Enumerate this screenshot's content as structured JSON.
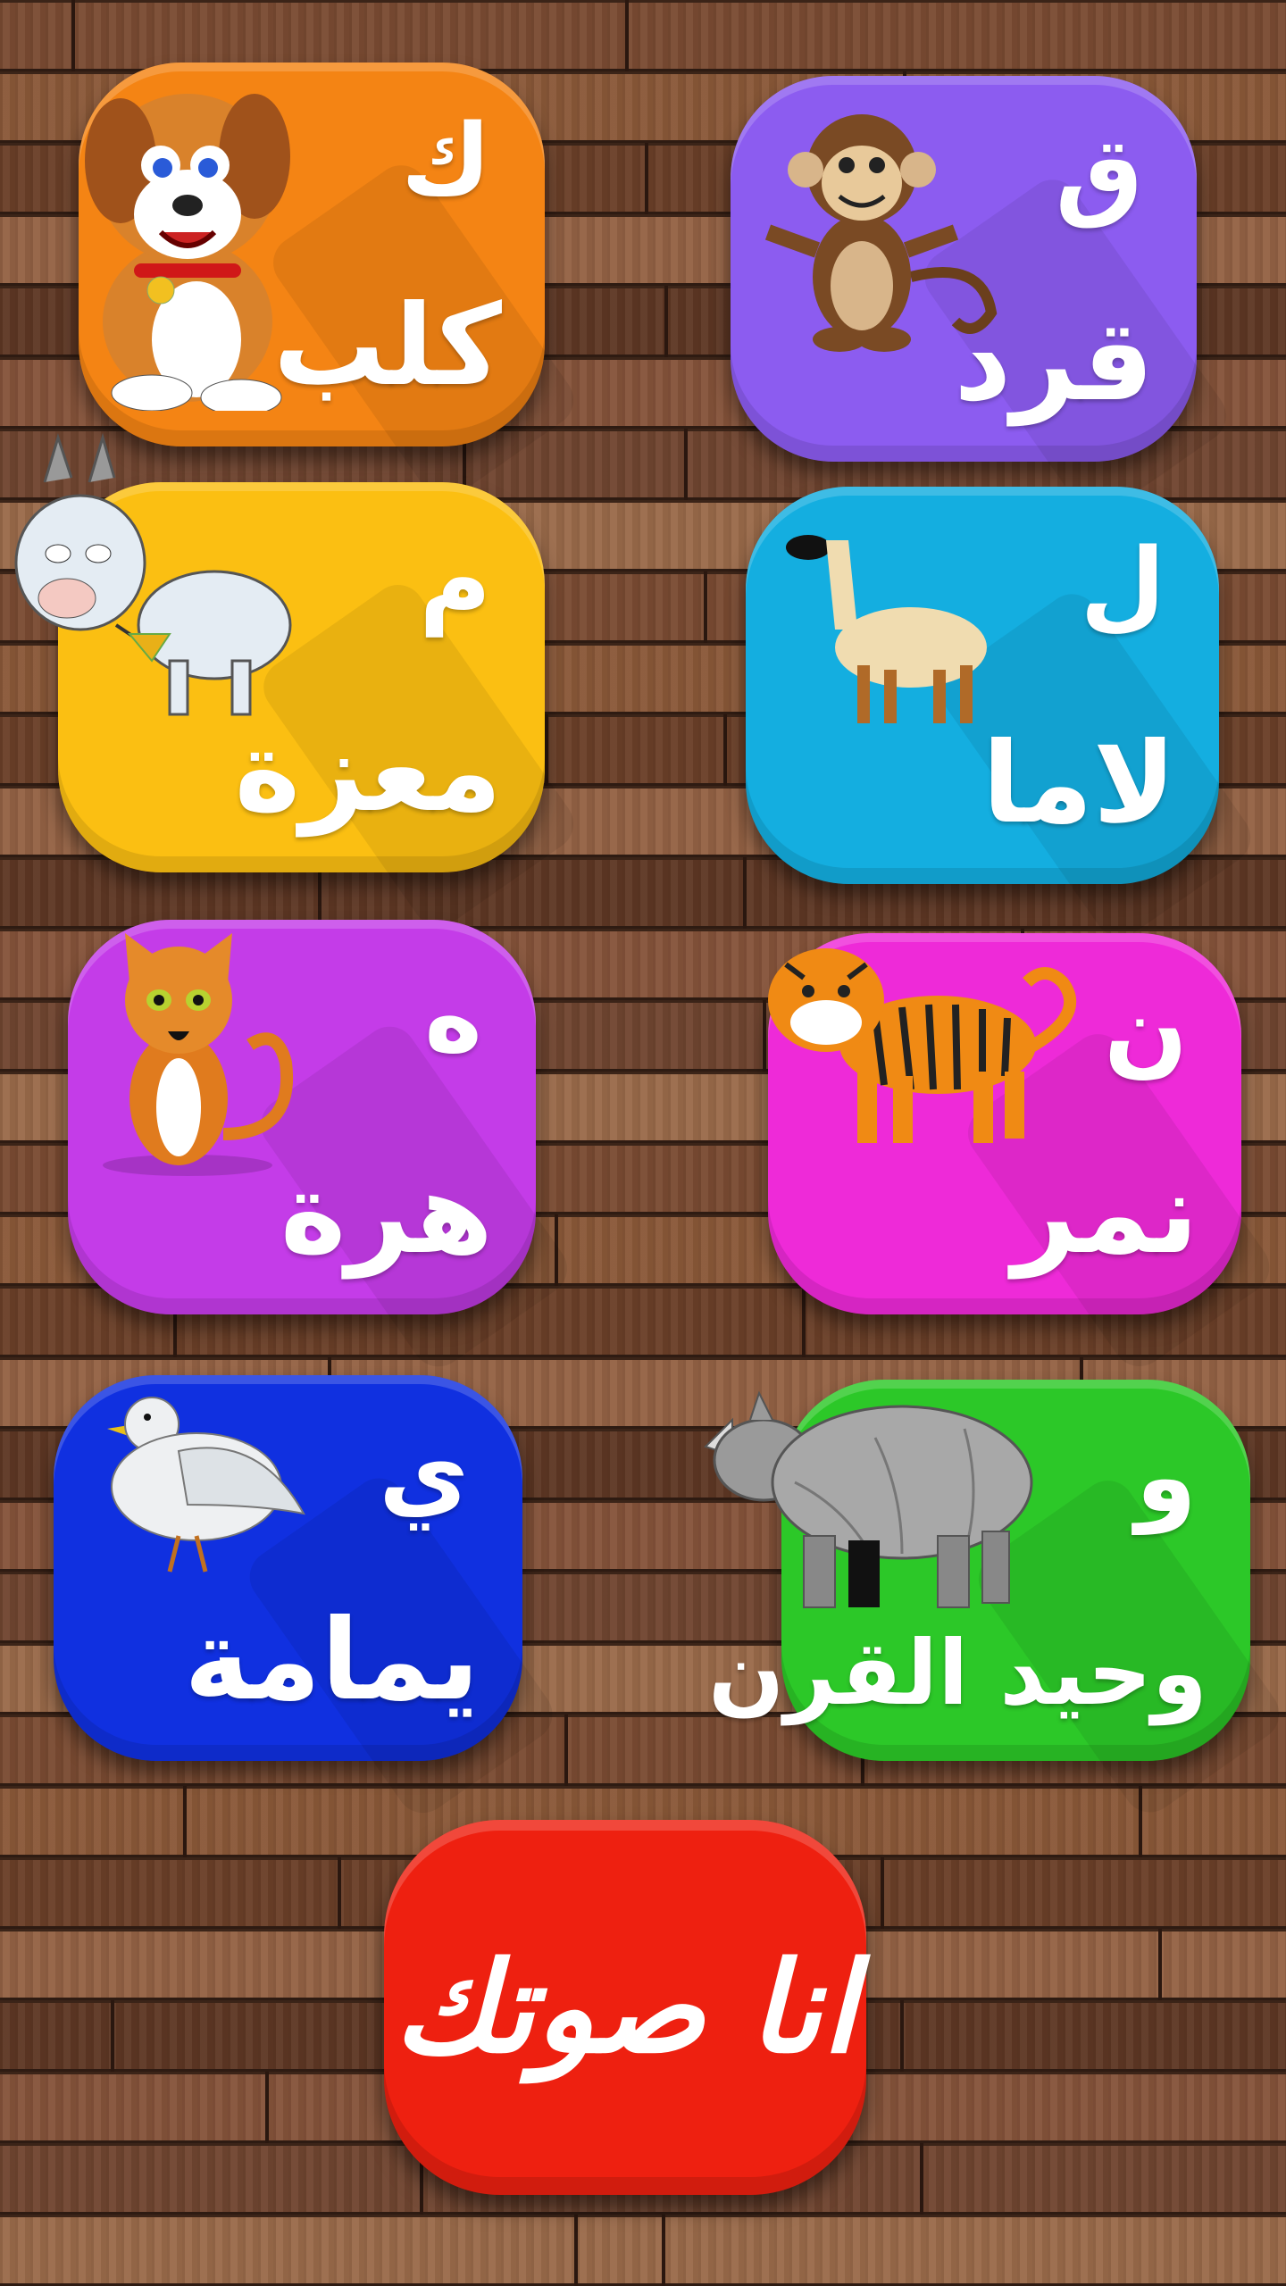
{
  "tiles": [
    {
      "letter": "ك",
      "word": "كلب",
      "animal": "dog",
      "color": "#f48414"
    },
    {
      "letter": "ق",
      "word": "قرد",
      "animal": "monkey",
      "color": "#8c5cf0"
    },
    {
      "letter": "م",
      "word": "معزة",
      "animal": "goat",
      "color": "#fbbf12"
    },
    {
      "letter": "ل",
      "word": "لاما",
      "animal": "llama",
      "color": "#14aee0"
    },
    {
      "letter": "ه",
      "word": "هرة",
      "animal": "cat",
      "color": "#c43ce8"
    },
    {
      "letter": "ن",
      "word": "نمر",
      "animal": "tiger",
      "color": "#ee2ad8"
    },
    {
      "letter": "ي",
      "word": "يمامة",
      "animal": "dove",
      "color": "#1030e0"
    },
    {
      "letter": "و",
      "word": "وحيد القرن",
      "animal": "rhino",
      "color": "#2cc828"
    }
  ],
  "main_button": {
    "label": "انا صوتك",
    "color": "#ee2010"
  }
}
